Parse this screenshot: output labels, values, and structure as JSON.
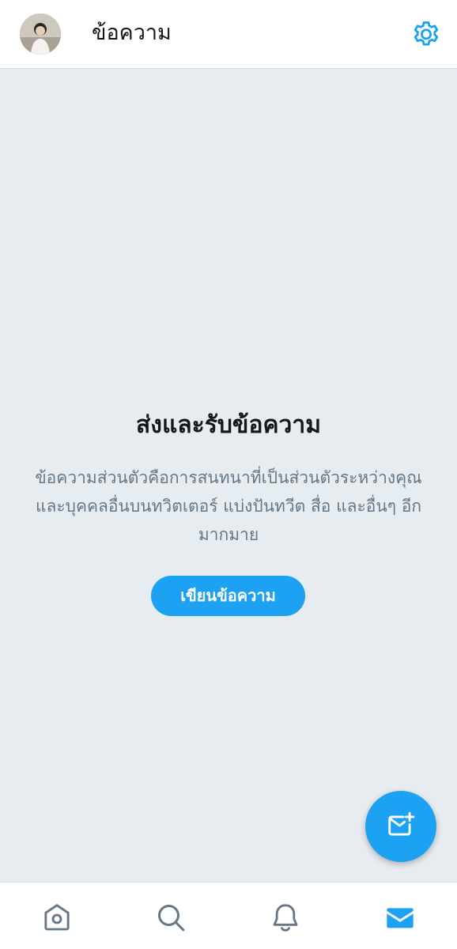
{
  "header": {
    "title": "ข้อความ",
    "avatar_icon": "user-avatar",
    "settings_icon": "gear-icon"
  },
  "empty_state": {
    "title": "ส่งและรับข้อความ",
    "description": "ข้อความส่วนตัวคือการสนทนาที่เป็นส่วนตัวระหว่างคุณและบุคคลอื่นบนทวิตเตอร์ แบ่งปันทวีต สื่อ และอื่นๆ อีกมากมาย",
    "compose_label": "เขียนข้อความ"
  },
  "fab": {
    "icon": "new-message-icon"
  },
  "bottom_nav": {
    "items": [
      {
        "icon": "home-icon",
        "active": false
      },
      {
        "icon": "search-icon",
        "active": false
      },
      {
        "icon": "bell-icon",
        "active": false
      },
      {
        "icon": "mail-icon",
        "active": true
      }
    ]
  },
  "colors": {
    "accent": "#1da1f2",
    "background": "#e6ecf0",
    "text_primary": "#14171a",
    "text_secondary": "#657786",
    "icon_inactive": "#657786"
  }
}
